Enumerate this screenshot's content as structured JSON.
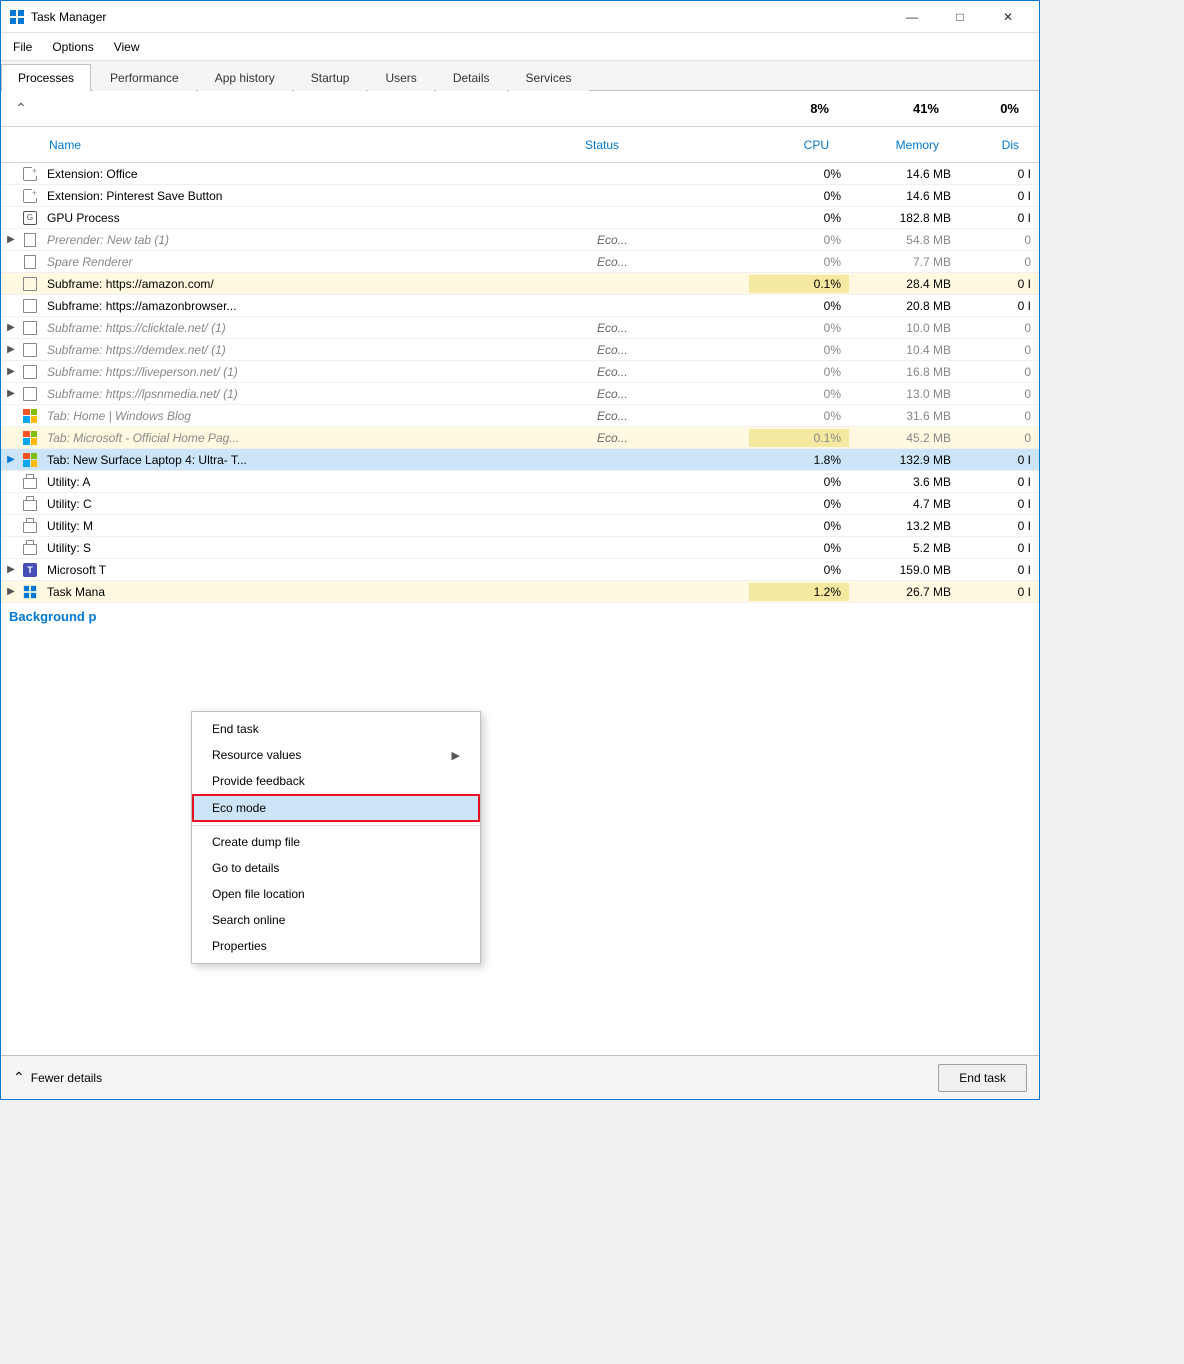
{
  "window": {
    "title": "Task Manager",
    "controls": {
      "minimize": "—",
      "maximize": "□",
      "close": "✕"
    }
  },
  "menu": {
    "items": [
      "File",
      "Options",
      "View"
    ]
  },
  "tabs": [
    {
      "label": "Processes",
      "active": true
    },
    {
      "label": "Performance",
      "active": false
    },
    {
      "label": "App history",
      "active": false
    },
    {
      "label": "Startup",
      "active": false
    },
    {
      "label": "Users",
      "active": false
    },
    {
      "label": "Details",
      "active": false
    },
    {
      "label": "Services",
      "active": false
    }
  ],
  "columns": {
    "name": "Name",
    "status": "Status",
    "cpu": "CPU",
    "memory": "Memory",
    "disk": "Dis"
  },
  "usage": {
    "cpu": "8%",
    "memory": "41%",
    "disk": "0%"
  },
  "processes": [
    {
      "indent": false,
      "name": "Extension: Office",
      "status": "",
      "cpu": "0%",
      "memory": "14.6 MB",
      "disk": "0 I",
      "highlight": false,
      "eco": false
    },
    {
      "indent": false,
      "name": "Extension: Pinterest Save Button",
      "status": "",
      "cpu": "0%",
      "memory": "14.6 MB",
      "disk": "0 I",
      "highlight": false,
      "eco": false
    },
    {
      "indent": false,
      "name": "GPU Process",
      "status": "",
      "cpu": "0%",
      "memory": "182.8 MB",
      "disk": "0 I",
      "highlight": false,
      "eco": false
    },
    {
      "indent": true,
      "name": "Prerender: New tab (1)",
      "status": "Eco...",
      "cpu": "0%",
      "memory": "54.8 MB",
      "disk": "0",
      "highlight": false,
      "eco": true
    },
    {
      "indent": false,
      "name": "Spare Renderer",
      "status": "Eco...",
      "cpu": "0%",
      "memory": "7.7 MB",
      "disk": "0",
      "highlight": false,
      "eco": true
    },
    {
      "indent": false,
      "name": "Subframe: https://amazon.com/",
      "status": "",
      "cpu": "0.1%",
      "memory": "28.4 MB",
      "disk": "0 I",
      "highlight": true,
      "eco": false
    },
    {
      "indent": false,
      "name": "Subframe: https://amazonbrowser...",
      "status": "",
      "cpu": "0%",
      "memory": "20.8 MB",
      "disk": "0 I",
      "highlight": false,
      "eco": false
    },
    {
      "indent": true,
      "name": "Subframe: https://clicktale.net/ (1)",
      "status": "Eco...",
      "cpu": "0%",
      "memory": "10.0 MB",
      "disk": "0",
      "highlight": false,
      "eco": true
    },
    {
      "indent": true,
      "name": "Subframe: https://demdex.net/ (1)",
      "status": "Eco...",
      "cpu": "0%",
      "memory": "10.4 MB",
      "disk": "0",
      "highlight": false,
      "eco": true
    },
    {
      "indent": true,
      "name": "Subframe: https://liveperson.net/ (1)",
      "status": "Eco...",
      "cpu": "0%",
      "memory": "16.8 MB",
      "disk": "0",
      "highlight": false,
      "eco": true
    },
    {
      "indent": true,
      "name": "Subframe: https://lpsnmedia.net/ (1)",
      "status": "Eco...",
      "cpu": "0%",
      "memory": "13.0 MB",
      "disk": "0",
      "highlight": false,
      "eco": true
    },
    {
      "indent": false,
      "name": "Tab: Home | Windows Blog",
      "status": "Eco...",
      "cpu": "0%",
      "memory": "31.6 MB",
      "disk": "0",
      "highlight": false,
      "eco": true
    },
    {
      "indent": false,
      "name": "Tab: Microsoft - Official Home Pag...",
      "status": "Eco...",
      "cpu": "0.1%",
      "memory": "45.2 MB",
      "disk": "0",
      "highlight": true,
      "eco": true
    },
    {
      "indent": true,
      "name": "Tab: New Surface Laptop 4: Ultra- T...",
      "status": "",
      "cpu": "1.8%",
      "memory": "132.9 MB",
      "disk": "0 I",
      "highlight": false,
      "eco": false,
      "selected": true
    },
    {
      "indent": false,
      "name": "Utility: A",
      "status": "",
      "cpu": "0%",
      "memory": "3.6 MB",
      "disk": "0 I",
      "highlight": false,
      "eco": false
    },
    {
      "indent": false,
      "name": "Utility: C",
      "status": "",
      "cpu": "0%",
      "memory": "4.7 MB",
      "disk": "0 I",
      "highlight": false,
      "eco": false
    },
    {
      "indent": false,
      "name": "Utility: M",
      "status": "",
      "cpu": "0%",
      "memory": "13.2 MB",
      "disk": "0 I",
      "highlight": false,
      "eco": false
    },
    {
      "indent": false,
      "name": "Utility: S",
      "status": "",
      "cpu": "0%",
      "memory": "5.2 MB",
      "disk": "0 I",
      "highlight": false,
      "eco": false
    }
  ],
  "other_processes": [
    {
      "indent": true,
      "name": "Microsoft T",
      "status": "",
      "cpu": "0%",
      "memory": "159.0 MB",
      "disk": "0 I",
      "highlight": false,
      "isTeams": true
    },
    {
      "indent": true,
      "name": "Task Mana",
      "status": "",
      "cpu": "1.2%",
      "memory": "26.7 MB",
      "disk": "0 I",
      "highlight": true,
      "isTask": true
    }
  ],
  "background_label": "Background p",
  "context_menu": {
    "items": [
      {
        "label": "End task",
        "type": "item"
      },
      {
        "label": "Resource values",
        "type": "item",
        "arrow": true
      },
      {
        "label": "Provide feedback",
        "type": "item"
      },
      {
        "label": "Eco mode",
        "type": "item",
        "highlighted": true
      },
      {
        "type": "separator"
      },
      {
        "label": "Create dump file",
        "type": "item"
      },
      {
        "label": "Go to details",
        "type": "item"
      },
      {
        "label": "Open file location",
        "type": "item"
      },
      {
        "label": "Search online",
        "type": "item"
      },
      {
        "label": "Properties",
        "type": "item"
      }
    ]
  },
  "bottom": {
    "fewer_details": "Fewer details",
    "end_task": "End task"
  }
}
